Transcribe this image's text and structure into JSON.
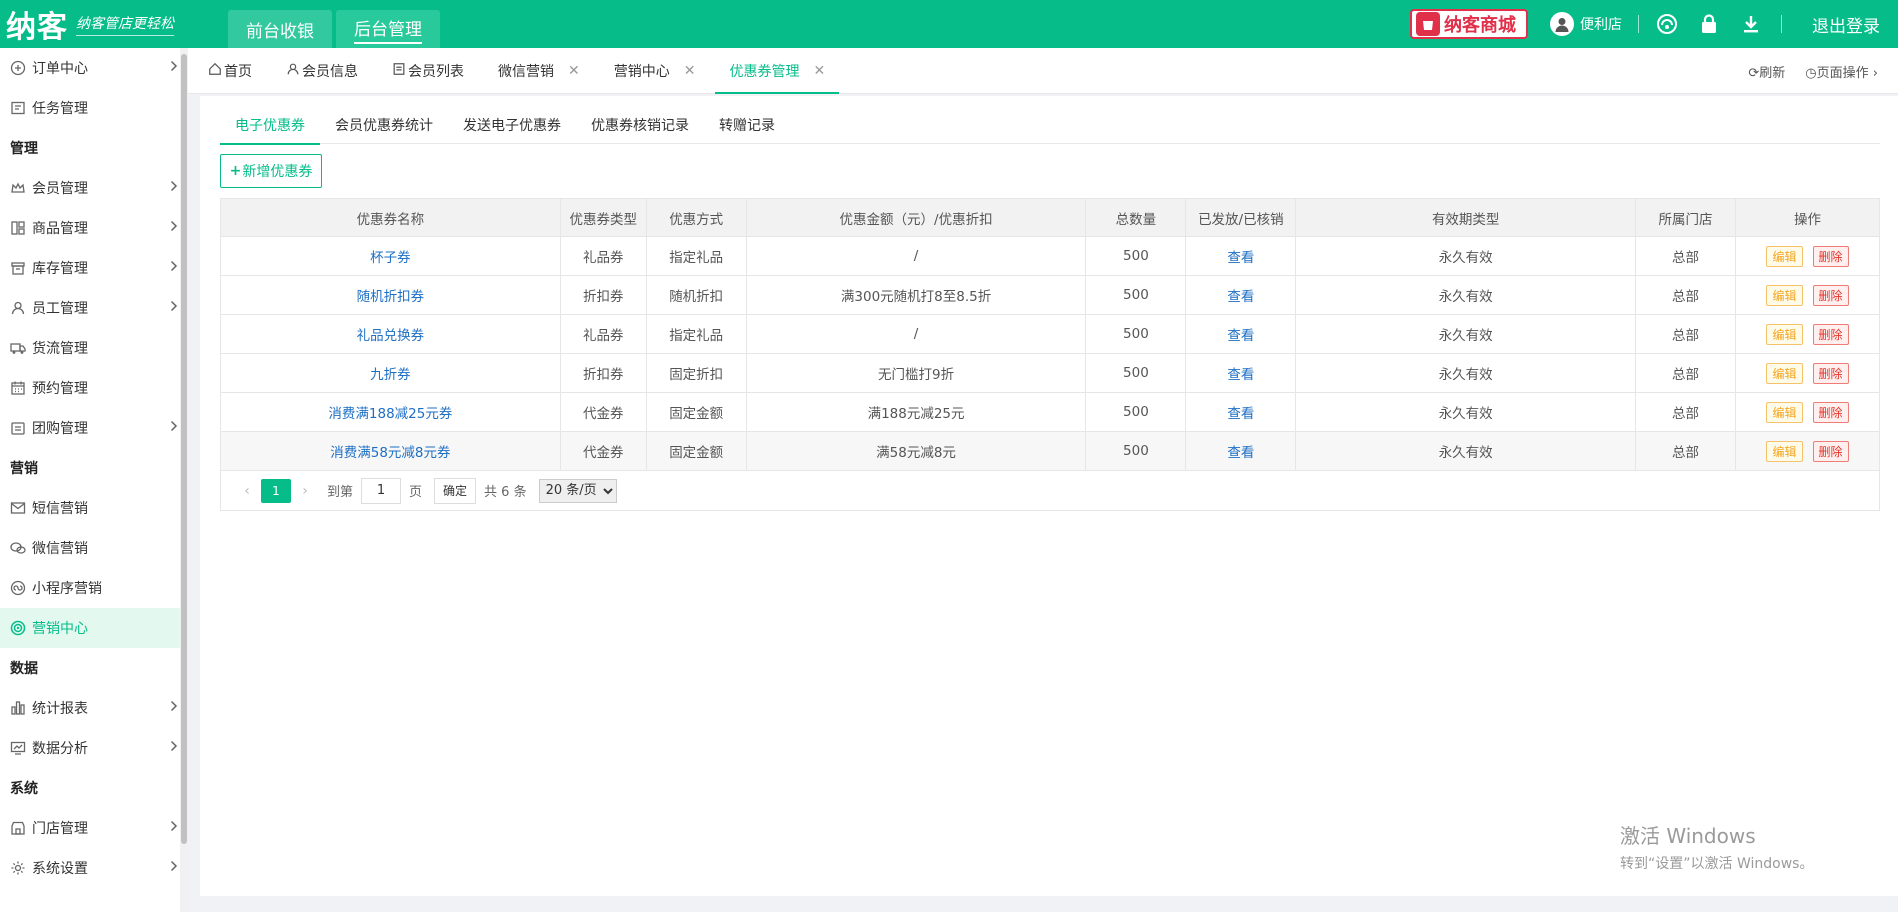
{
  "topbar": {
    "logo": "纳客",
    "slogan": "纳客管店更轻松",
    "nav": [
      "前台收银",
      "后台管理"
    ],
    "mall": "纳客商城",
    "store": "便利店",
    "logout": "退出登录"
  },
  "sidebar": {
    "items": [
      {
        "label": "订单中心",
        "icon": "order-icon",
        "arrow": true
      },
      {
        "label": "任务管理",
        "icon": "task-icon",
        "arrow": false
      },
      {
        "group": "管理"
      },
      {
        "label": "会员管理",
        "icon": "crown-icon",
        "arrow": true
      },
      {
        "label": "商品管理",
        "icon": "goods-icon",
        "arrow": true
      },
      {
        "label": "库存管理",
        "icon": "inventory-icon",
        "arrow": true
      },
      {
        "label": "员工管理",
        "icon": "staff-icon",
        "arrow": true
      },
      {
        "label": "货流管理",
        "icon": "truck-icon",
        "arrow": false
      },
      {
        "label": "预约管理",
        "icon": "calendar-icon",
        "arrow": false
      },
      {
        "label": "团购管理",
        "icon": "groupbuy-icon",
        "arrow": true
      },
      {
        "group": "营销"
      },
      {
        "label": "短信营销",
        "icon": "sms-icon",
        "arrow": false
      },
      {
        "label": "微信营销",
        "icon": "wechat-icon",
        "arrow": false
      },
      {
        "label": "小程序营销",
        "icon": "miniprogram-icon",
        "arrow": false
      },
      {
        "label": "营销中心",
        "icon": "target-icon",
        "arrow": false,
        "active": true
      },
      {
        "group": "数据"
      },
      {
        "label": "统计报表",
        "icon": "report-icon",
        "arrow": true
      },
      {
        "label": "数据分析",
        "icon": "analysis-icon",
        "arrow": true
      },
      {
        "group": "系统"
      },
      {
        "label": "门店管理",
        "icon": "store-icon",
        "arrow": true
      },
      {
        "label": "系统设置",
        "icon": "gear-icon",
        "arrow": true
      }
    ]
  },
  "tabs": [
    {
      "label": "首页",
      "icon": "home-icon",
      "closable": false
    },
    {
      "label": "会员信息",
      "icon": "user-icon",
      "closable": false
    },
    {
      "label": "会员列表",
      "icon": "list-icon",
      "closable": false
    },
    {
      "label": "微信营销",
      "closable": true
    },
    {
      "label": "营销中心",
      "closable": true
    },
    {
      "label": "优惠券管理",
      "closable": true,
      "active": true
    }
  ],
  "tab_tools": {
    "refresh": "刷新",
    "page_ops": "页面操作"
  },
  "subtabs": [
    "电子优惠券",
    "会员优惠券统计",
    "发送电子优惠券",
    "优惠券核销记录",
    "转赠记录"
  ],
  "add_button": "新增优惠券",
  "table": {
    "headers": [
      "优惠券名称",
      "优惠券类型",
      "优惠方式",
      "优惠金额（元）/优惠折扣",
      "总数量",
      "已发放/已核销",
      "有效期类型",
      "所属门店",
      "操作"
    ],
    "rows": [
      [
        "杯子券",
        "礼品券",
        "指定礼品",
        "/",
        "500",
        "查看",
        "永久有效",
        "总部"
      ],
      [
        "随机折扣券",
        "折扣券",
        "随机折扣",
        "满300元随机打8至8.5折",
        "500",
        "查看",
        "永久有效",
        "总部"
      ],
      [
        "礼品兑换券",
        "礼品券",
        "指定礼品",
        "/",
        "500",
        "查看",
        "永久有效",
        "总部"
      ],
      [
        "九折券",
        "折扣券",
        "固定折扣",
        "无门槛打9折",
        "500",
        "查看",
        "永久有效",
        "总部"
      ],
      [
        "消费满188减25元券",
        "代金券",
        "固定金额",
        "满188元减25元",
        "500",
        "查看",
        "永久有效",
        "总部"
      ],
      [
        "消费满58元减8元券",
        "代金券",
        "固定金额",
        "满58元减8元",
        "500",
        "查看",
        "永久有效",
        "总部"
      ]
    ],
    "edit": "编辑",
    "delete": "删除"
  },
  "pager": {
    "current": "1",
    "goto": "到第",
    "input": "1",
    "page": "页",
    "confirm": "确定",
    "total": "共 6 条",
    "page_size": "20 条/页"
  },
  "watermark": {
    "line1": "激活 Windows",
    "line2": "转到“设置”以激活 Windows。"
  },
  "colors": {
    "accent": "#06bd8a",
    "link": "#1e6fc4",
    "edit": "#f5a623",
    "delete": "#e5342a"
  }
}
